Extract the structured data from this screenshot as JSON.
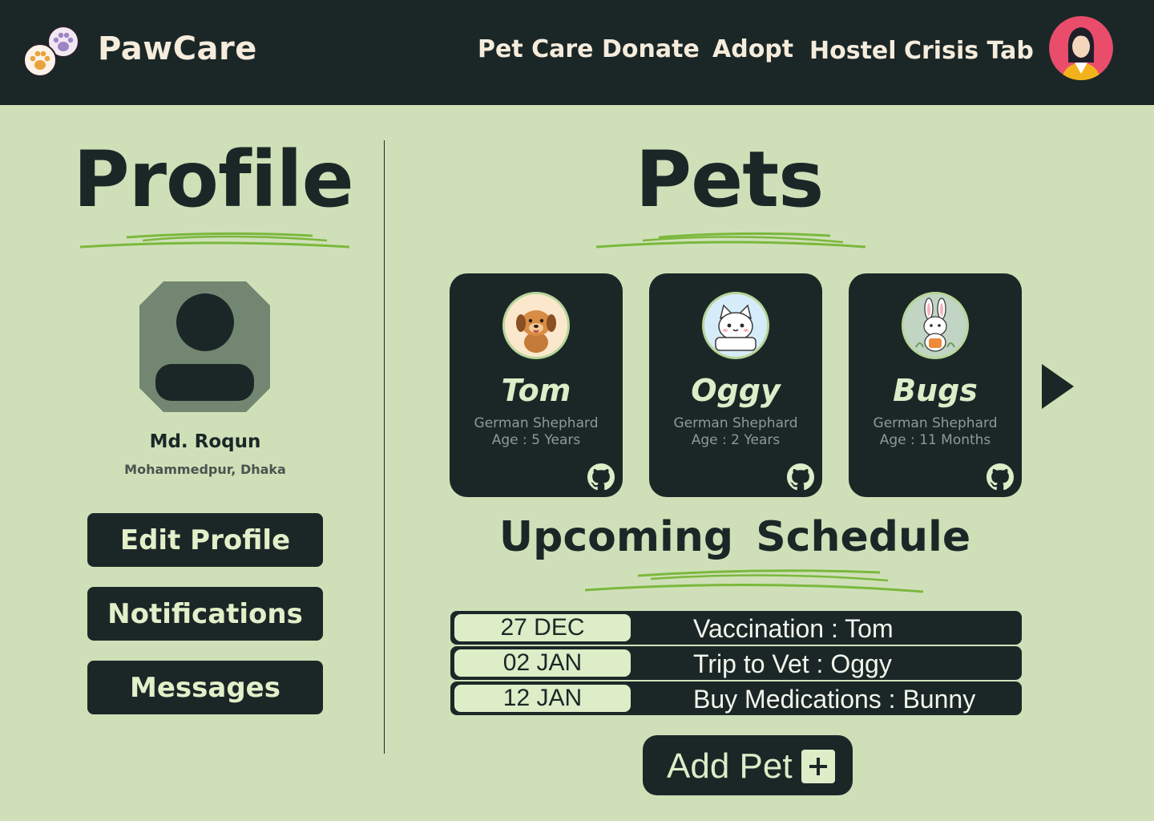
{
  "header": {
    "brand": "PawCare",
    "nav": [
      "Pet Care",
      "Donate",
      "Adopt",
      "Hostel",
      "Crisis Tab"
    ]
  },
  "profile": {
    "title": "Profile",
    "name": "Md. Roqun",
    "location": "Mohammedpur, Dhaka",
    "buttons": [
      "Edit Profile",
      "Notifications",
      "Messages"
    ]
  },
  "pets": {
    "title": "Pets",
    "items": [
      {
        "name": "Tom",
        "breed": "German Shephard",
        "age": "Age : 5 Years",
        "icon": "dog-icon"
      },
      {
        "name": "Oggy",
        "breed": "German Shephard",
        "age": "Age : 2 Years",
        "icon": "cat-icon"
      },
      {
        "name": "Bugs",
        "breed": "German Shephard",
        "age": "Age : 11 Months",
        "icon": "bunny-icon"
      }
    ]
  },
  "schedule": {
    "title": "Upcoming Schedule",
    "items": [
      {
        "date": "27 DEC",
        "event": "Vaccination : Tom"
      },
      {
        "date": "02 JAN",
        "event": "Trip to Vet : Oggy"
      },
      {
        "date": "12 JAN",
        "event": "Buy Medications : Bunny"
      }
    ]
  },
  "add_pet": {
    "label": "Add Pet"
  },
  "colors": {
    "dark": "#1b2727",
    "background": "#cfe0b8",
    "accent_green": "#7bb83c",
    "cream": "#f6ecdc"
  }
}
